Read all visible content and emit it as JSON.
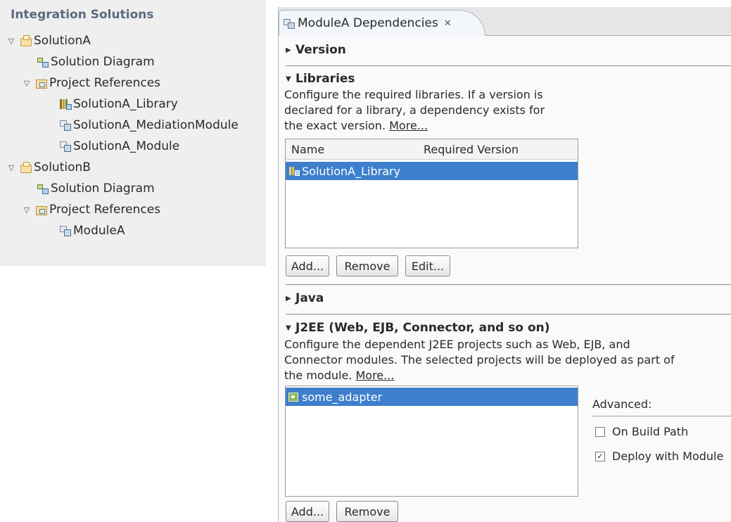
{
  "tree": {
    "title": "Integration Solutions",
    "nodes": [
      {
        "label": "SolutionA",
        "icon": "solution-icon",
        "expanded": true
      },
      {
        "label": "Solution Diagram",
        "icon": "diagram-icon"
      },
      {
        "label": "Project References",
        "icon": "project-references-icon",
        "expanded": true
      },
      {
        "label": "SolutionA_Library",
        "icon": "library-icon"
      },
      {
        "label": "SolutionA_MediationModule",
        "icon": "module-icon"
      },
      {
        "label": "SolutionA_Module",
        "icon": "module-icon"
      },
      {
        "label": "SolutionB",
        "icon": "solution-icon",
        "expanded": true
      },
      {
        "label": "Solution Diagram",
        "icon": "diagram-icon"
      },
      {
        "label": "Project References",
        "icon": "project-references-icon",
        "expanded": true
      },
      {
        "label": "ModuleA",
        "icon": "module-icon"
      }
    ]
  },
  "editor": {
    "tab_title": "ModuleA Dependencies",
    "tab_close": "✕",
    "sections": {
      "version": {
        "title": "Version",
        "expanded": false
      },
      "libraries": {
        "title": "Libraries",
        "expanded": true,
        "desc_line1": "Configure the required libraries.  If a version is",
        "desc_line2": "declared for a library, a dependency exists for",
        "desc_line3": "the exact version.",
        "more_link": "More...",
        "columns": [
          "Name",
          "Required Version"
        ],
        "rows": [
          {
            "name": "SolutionA_Library",
            "required_version": "",
            "selected": true
          }
        ],
        "buttons": {
          "add": "Add...",
          "remove": "Remove",
          "edit": "Edit..."
        }
      },
      "java": {
        "title": "Java",
        "expanded": false
      },
      "j2ee": {
        "title": "J2EE (Web, EJB, Connector, and so on)",
        "expanded": true,
        "desc_line1": "Configure the dependent J2EE projects such as Web, EJB, and",
        "desc_line2": "Connector modules.  The selected projects will be deployed as part of",
        "desc_line3": "the module.",
        "more_link": "More...",
        "rows": [
          {
            "name": "some_adapter",
            "selected": true
          }
        ],
        "advanced": {
          "label": "Advanced:",
          "on_build_path": {
            "label": "On Build Path",
            "checked": false
          },
          "deploy_with_module": {
            "label": "Deploy with Module",
            "checked": true,
            "check_glyph": "✓"
          }
        },
        "buttons": {
          "add": "Add...",
          "remove": "Remove"
        }
      }
    }
  },
  "colors": {
    "selection": "#3d7fcc",
    "tree_title": "#5a6a7d",
    "panel_bg": "#efefef"
  }
}
